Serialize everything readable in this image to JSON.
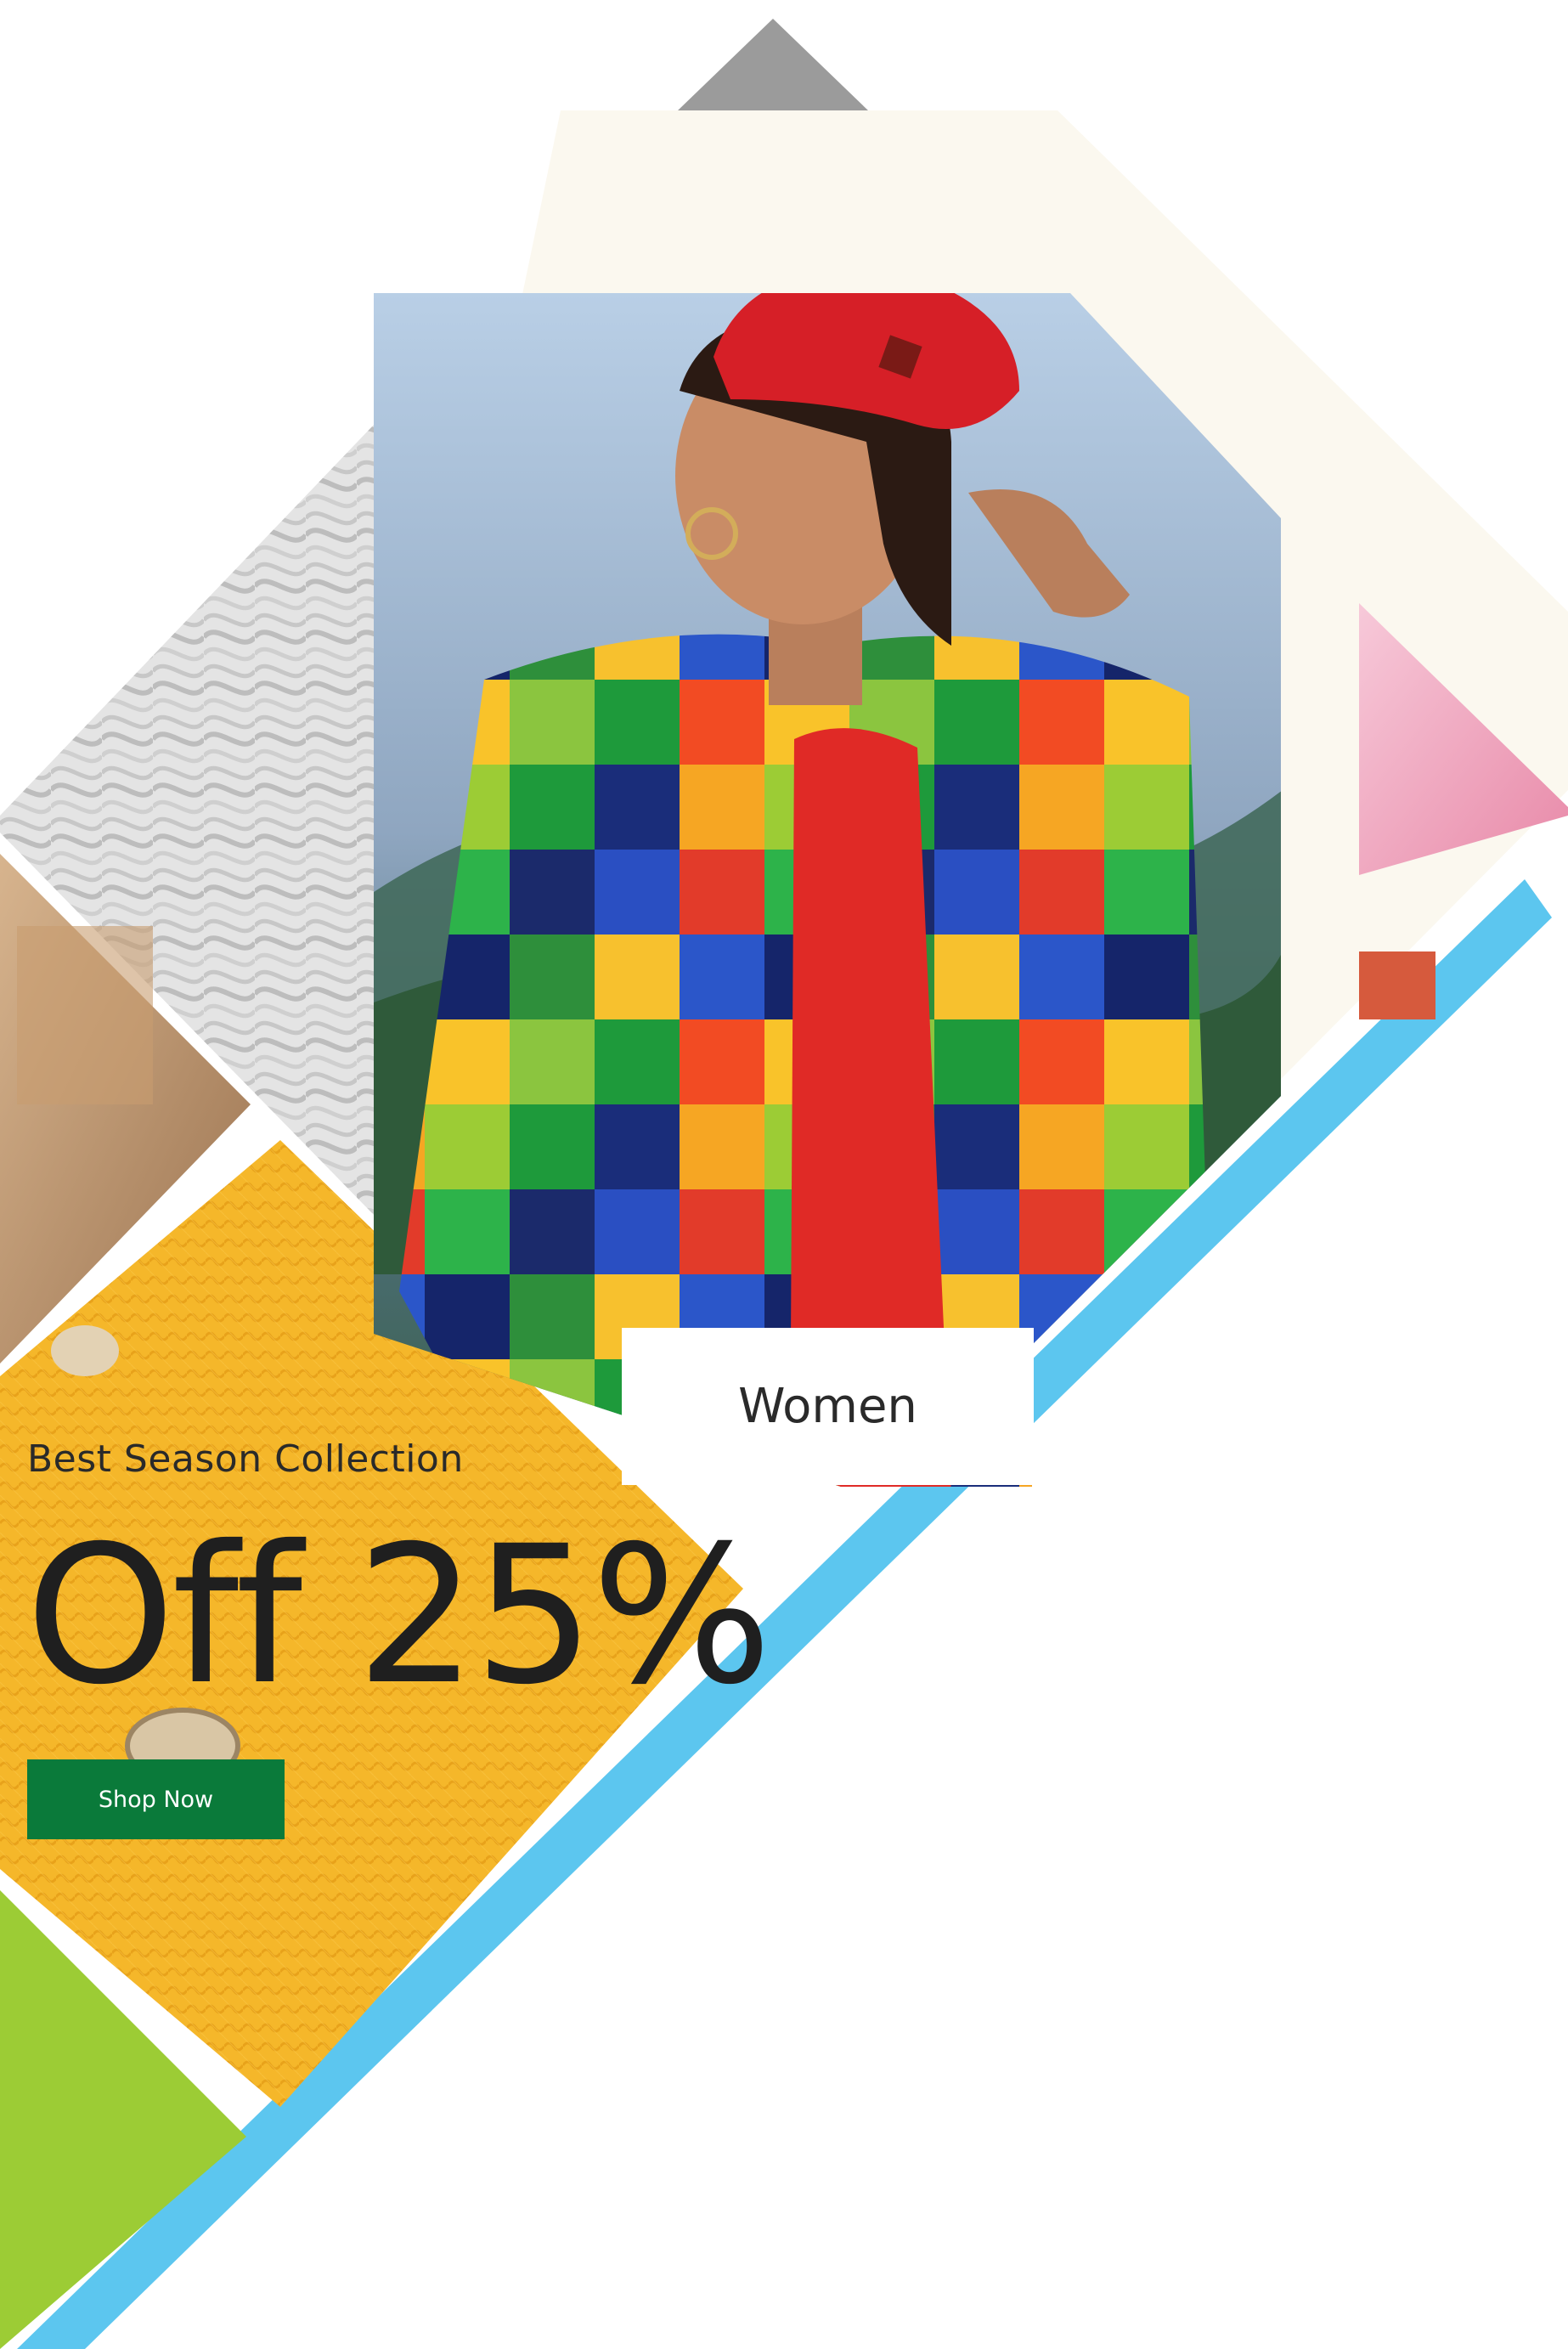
{
  "promo": {
    "tagline": "Best Season Collection",
    "headline": "Off 25%",
    "cta_label": "Shop Now"
  },
  "category": {
    "label": "Women"
  },
  "colors": {
    "cta_background": "#0a7a3a",
    "accent_blue": "#5cc6ef",
    "accent_green": "#9ccc35",
    "accent_gray": "#9b9b9b",
    "cream": "#fbf8ef",
    "sweater_yellow": "#f6b92b"
  }
}
